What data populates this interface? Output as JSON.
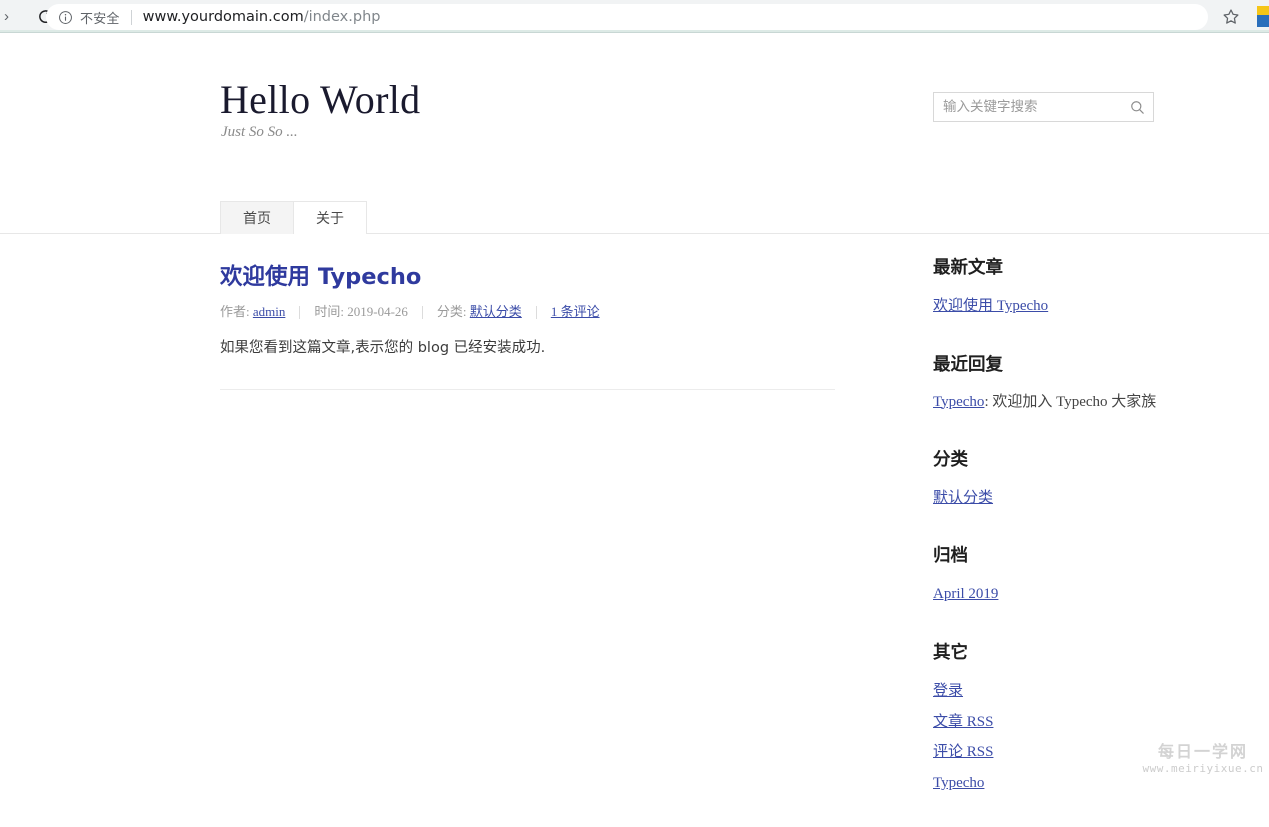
{
  "browser": {
    "forward_glyph": "›",
    "reload_icon": "reload-icon",
    "security_icon": "info-circle-icon",
    "security_label": "不安全",
    "url_host": "www.yourdomain.com",
    "url_path": "/index.php",
    "star_icon": "star-icon",
    "extension_icon": "extension-icon"
  },
  "site": {
    "title": "Hello World",
    "description": "Just So So ..."
  },
  "search": {
    "placeholder": "输入关键字搜索",
    "value": "",
    "icon": "search-icon"
  },
  "nav": {
    "items": [
      {
        "label": "首页",
        "active": true
      },
      {
        "label": "关于",
        "active": false
      }
    ]
  },
  "post": {
    "title": "欢迎使用 Typecho",
    "meta": {
      "author_label": "作者:",
      "author": "admin",
      "date_label": "时间:",
      "date": "2019-04-26",
      "category_label": "分类:",
      "category": "默认分类",
      "comments": "1 条评论"
    },
    "body": "如果您看到这篇文章,表示您的 blog 已经安装成功."
  },
  "sidebar": {
    "recent_posts": {
      "title": "最新文章",
      "items": [
        "欢迎使用 Typecho"
      ]
    },
    "recent_comments": {
      "title": "最近回复",
      "items": [
        {
          "author": "Typecho",
          "separator": ": ",
          "text": "欢迎加入 Typecho 大家族"
        }
      ]
    },
    "categories": {
      "title": "分类",
      "items": [
        "默认分类"
      ]
    },
    "archives": {
      "title": "归档",
      "items": [
        "April 2019"
      ]
    },
    "other": {
      "title": "其它",
      "items": [
        "登录",
        "文章 RSS",
        "评论 RSS",
        "Typecho"
      ]
    }
  },
  "watermark": {
    "top": "每日一学网",
    "bottom": "www.meiriyixue.cn"
  },
  "colors": {
    "link": "#3b4ca8",
    "post_title": "#2f3a9e",
    "meta_text": "#9a9a9a",
    "chrome_bg": "#f1f3f4",
    "active_tab_bg": "#f4f4f4"
  }
}
